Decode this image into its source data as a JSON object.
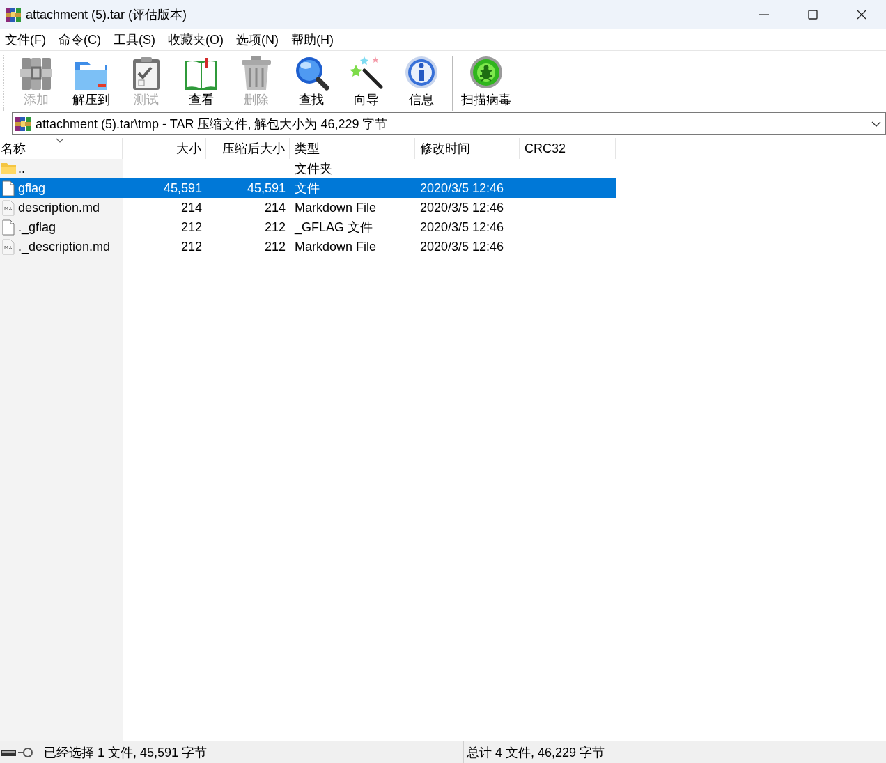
{
  "window": {
    "title": "attachment (5).tar (评估版本)"
  },
  "menu": [
    "文件(F)",
    "命令(C)",
    "工具(S)",
    "收藏夹(O)",
    "选项(N)",
    "帮助(H)"
  ],
  "toolbar": [
    {
      "kind": "add",
      "label": "添加",
      "disabled": true
    },
    {
      "kind": "extract",
      "label": "解压到",
      "disabled": false
    },
    {
      "kind": "test",
      "label": "测试",
      "disabled": true
    },
    {
      "kind": "view",
      "label": "查看",
      "disabled": false
    },
    {
      "kind": "delete",
      "label": "删除",
      "disabled": true
    },
    {
      "kind": "find",
      "label": "查找",
      "disabled": false
    },
    {
      "kind": "wizard",
      "label": "向导",
      "disabled": false
    },
    {
      "kind": "info",
      "label": "信息",
      "disabled": false
    },
    {
      "kind": "scan",
      "label": "扫描病毒",
      "disabled": false
    }
  ],
  "address": {
    "value": "attachment (5).tar\\tmp - TAR 压缩文件, 解包大小为 46,229 字节"
  },
  "table": {
    "columns": [
      {
        "label": "名称",
        "sorted": true
      },
      {
        "label": "大小",
        "sorted": false
      },
      {
        "label": "压缩后大小",
        "sorted": false
      },
      {
        "label": "类型",
        "sorted": false
      },
      {
        "label": "修改时间",
        "sorted": false
      },
      {
        "label": "CRC32",
        "sorted": false
      }
    ],
    "rows": [
      {
        "kind": "folder",
        "name": "..",
        "size": "",
        "packed": "",
        "type": "文件夹",
        "modified": "",
        "selected": false
      },
      {
        "kind": "file",
        "name": "gflag",
        "size": "45,591",
        "packed": "45,591",
        "type": "文件",
        "modified": "2020/3/5 12:46",
        "selected": true
      },
      {
        "kind": "markdown",
        "name": "description.md",
        "size": "214",
        "packed": "214",
        "type": "Markdown File",
        "modified": "2020/3/5 12:46",
        "selected": false
      },
      {
        "kind": "file",
        "name": "._gflag",
        "size": "212",
        "packed": "212",
        "type": "_GFLAG 文件",
        "modified": "2020/3/5 12:46",
        "selected": false
      },
      {
        "kind": "markdown",
        "name": "._description.md",
        "size": "212",
        "packed": "212",
        "type": "Markdown File",
        "modified": "2020/3/5 12:46",
        "selected": false
      }
    ]
  },
  "status_bar": {
    "selection": "已经选择 1 文件, 45,591 字节",
    "total": "总计 4 文件, 46,229 字节"
  }
}
